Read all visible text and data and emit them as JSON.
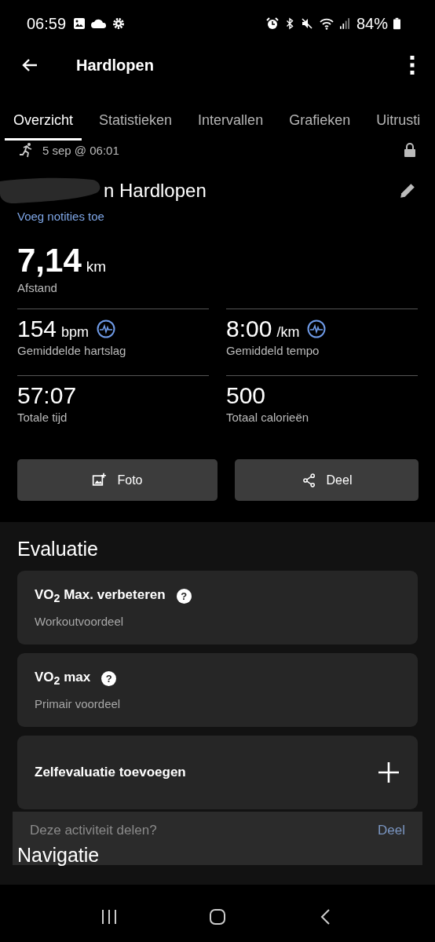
{
  "status_bar": {
    "time": "06:59",
    "battery": "84%"
  },
  "app_bar": {
    "title": "Hardlopen"
  },
  "tabs": [
    {
      "label": "Overzicht",
      "selected": true
    },
    {
      "label": "Statistieken",
      "selected": false
    },
    {
      "label": "Intervallen",
      "selected": false
    },
    {
      "label": "Grafieken",
      "selected": false
    },
    {
      "label": "Uitrusti",
      "selected": false
    }
  ],
  "activity": {
    "date": "5 sep @ 06:01",
    "title": "n Hardlopen",
    "notes_link": "Voeg notities toe"
  },
  "distance": {
    "value": "7,14",
    "unit": "km",
    "label": "Afstand"
  },
  "stats": [
    {
      "value": "154",
      "unit": "bpm",
      "label": "Gemiddelde hartslag",
      "has_chart_icon": true
    },
    {
      "value": "8:00",
      "unit": "/km",
      "label": "Gemiddeld tempo",
      "has_chart_icon": true
    },
    {
      "value": "57:07",
      "label": "Totale tijd",
      "has_chart_icon": false
    },
    {
      "value": "500",
      "label": "Totaal calorieën",
      "has_chart_icon": false
    }
  ],
  "actions": [
    {
      "label": "Foto"
    },
    {
      "label": "Deel"
    }
  ],
  "evaluation": {
    "heading": "Evaluatie",
    "cards": [
      {
        "kind": "info",
        "title": "VO$_{2}$ Max. verbeteren",
        "help": "?",
        "subtitle": "Workoutvoordeel"
      },
      {
        "kind": "info",
        "title": "VO$_{2}$ max",
        "help": "?",
        "subtitle": "Primair voordeel"
      },
      {
        "kind": "add",
        "title": "Zelfevaluatie toevoegen"
      }
    ]
  },
  "snackbar": {
    "message": "Deze activiteit delen?",
    "action": "Deel"
  },
  "next_heading": "Navigatie"
}
